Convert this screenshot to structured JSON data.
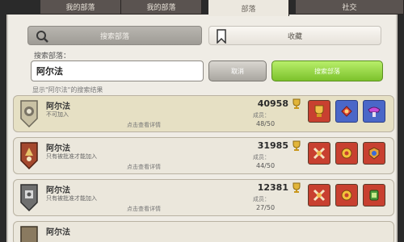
{
  "tabs": [
    {
      "label": "我的部落"
    },
    {
      "label": "我的部落"
    },
    {
      "label": "部落"
    },
    {
      "label": "社交"
    }
  ],
  "subtabs": {
    "search": "搜索部落",
    "saved": "收藏"
  },
  "search": {
    "label": "搜索部落：",
    "value": "阿尔法",
    "clear_label": "取消",
    "search_label": "搜索部落"
  },
  "result_note": "显示\"阿尔法\"的搜索结果",
  "clans": [
    {
      "name": "阿尔法",
      "status": "不可加入",
      "details": "点击查看详情",
      "score": "40958",
      "members_label": "成员：",
      "members": "48/50"
    },
    {
      "name": "阿尔法",
      "status": "只有被批准才能加入",
      "details": "点击查看详情",
      "score": "31985",
      "members_label": "成员：",
      "members": "44/50"
    },
    {
      "name": "阿尔法",
      "status": "只有被批准才能加入",
      "details": "点击查看详情",
      "score": "12381",
      "members_label": "成员：",
      "members": "27/50"
    },
    {
      "name": "阿尔法",
      "status": "",
      "details": "",
      "score": "",
      "members_label": "",
      "members": ""
    }
  ],
  "icons": {
    "badge": "clan-badge-icon",
    "trophy": "trophy-icon",
    "requirements": [
      "trophy-requirement-icon",
      "war-frequency-icon",
      "location-icon",
      "league-icon"
    ]
  },
  "colors": {
    "accent_green": "#7cc22c",
    "row_highlight": "#e6e0c4",
    "red_tile": "#c84030",
    "blue_tile": "#4a67c8"
  }
}
